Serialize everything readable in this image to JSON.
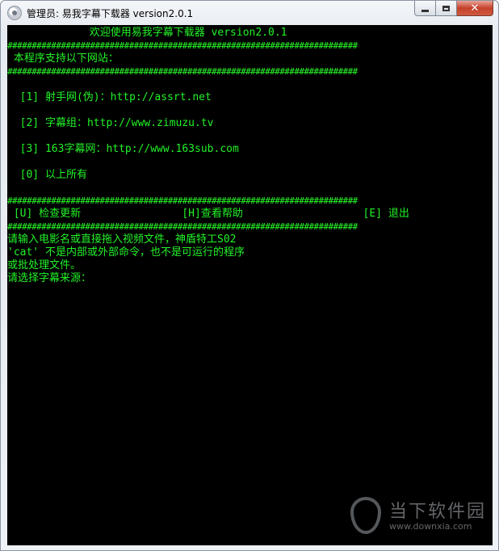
{
  "window": {
    "title": "管理员: 易我字幕下载器 version2.0.1"
  },
  "console": {
    "lines": [
      "             欢迎使用易我字幕下载器 version2.0.1",
      "########################################################################",
      " 本程序支持以下网站：",
      "########################################################################",
      "",
      "  [1] 射手网(伪)：http://assrt.net",
      "",
      "  [2] 字幕组：http://www.zimuzu.tv",
      "",
      "  [3] 163字幕网：http://www.163sub.com",
      "",
      "  [0] 以上所有",
      "",
      "########################################################################",
      " [U] 检查更新                [H]查看帮助                   [E] 退出",
      "########################################################################",
      "请输入电影名或直接拖入视频文件，神盾特工S02",
      "'cat' 不是内部或外部命令，也不是可运行的程序",
      "或批处理文件。",
      "请选择字幕来源："
    ]
  },
  "watermark": {
    "title": "当下软件园",
    "url": "www.downxia.com"
  },
  "colors": {
    "console_bg": "#000000",
    "console_text": "#22f227"
  }
}
